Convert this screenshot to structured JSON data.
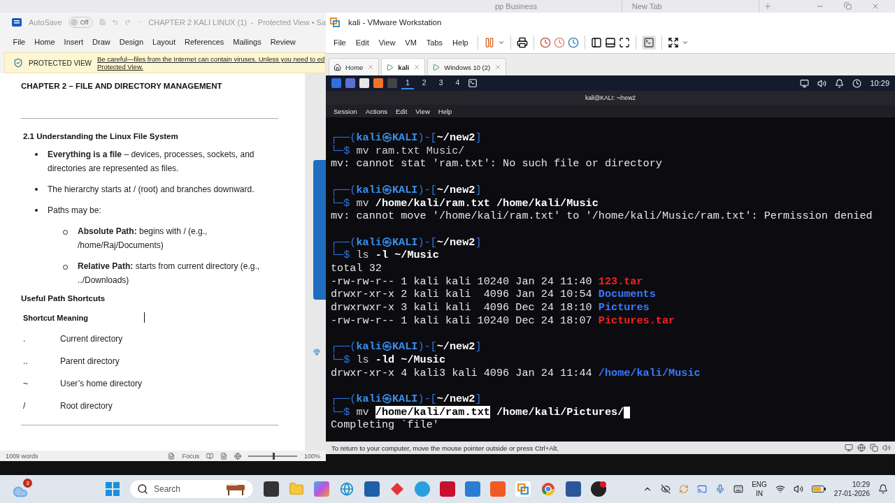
{
  "browser": {
    "tabs": [
      {
        "label": "pp Business",
        "selected": false
      },
      {
        "label": "New Tab",
        "selected": false
      }
    ]
  },
  "word": {
    "autosave": {
      "label": "AutoSave",
      "state": "Off",
      "on": false
    },
    "title": "CHAPTER 2 KALI LINUX (1)  -  Protected View • Sa",
    "ribbon_tabs": [
      "File",
      "Home",
      "Insert",
      "Draw",
      "Design",
      "Layout",
      "References",
      "Mailings",
      "Review"
    ],
    "protected_view": {
      "label": "PROTECTED VIEW",
      "message_lines": [
        "Be careful—files from the Internet can contain viruses. Unless you need to ed",
        "Protected View."
      ]
    },
    "document": {
      "heading": "CHAPTER 2 – FILE AND DIRECTORY MANAGEMENT",
      "section": "2.1 Understanding the Linux File System",
      "bullets": [
        {
          "text": "**Everything is a file** – devices, processes, sockets, and directories are represented as files."
        },
        {
          "text": "The hierarchy starts at / (root) and branches downward."
        },
        {
          "text": "Paths may be:",
          "children": [
            {
              "text": "**Absolute Path:** begins with / (e.g., /home/Raj/Documents)"
            },
            {
              "text": "**Relative Path:** starts from current directory (e.g., ../Downloads)"
            }
          ]
        }
      ],
      "subheading": "Useful Path Shortcuts",
      "table_header": "Shortcut Meaning",
      "shortcuts": [
        {
          "shortcut": ".",
          "meaning": "Current directory"
        },
        {
          "shortcut": "..",
          "meaning": "Parent directory"
        },
        {
          "shortcut": "~",
          "meaning": "User’s home directory"
        },
        {
          "shortcut": "/",
          "meaning": "Root directory"
        }
      ]
    },
    "status": {
      "words": "1009 words",
      "focus": "Focus",
      "zoom": "100%",
      "zoom_slider": {
        "level": 0.5
      }
    }
  },
  "vmware": {
    "title": "kali - VMware Workstation",
    "menu": [
      "File",
      "Edit",
      "View",
      "VM",
      "Tabs",
      "Help"
    ],
    "tabs": [
      {
        "label": "Home",
        "kind": "home",
        "selected": false
      },
      {
        "label": "kali",
        "kind": "vm",
        "selected": true
      },
      {
        "label": "Windows 10 (2)",
        "kind": "vm",
        "selected": false
      }
    ],
    "status": "To return to your computer, move the mouse pointer outside or press Ctrl+Alt."
  },
  "kali_panel": {
    "workspaces": [
      {
        "label": "1",
        "selected": true
      },
      {
        "label": "2",
        "selected": false
      },
      {
        "label": "3",
        "selected": false
      },
      {
        "label": "4",
        "selected": false
      }
    ],
    "clock": "10:29"
  },
  "terminal": {
    "title": "kali@KALI: ~/new2",
    "menu": [
      "Session",
      "Actions",
      "Edit",
      "View",
      "Help"
    ],
    "blocks": [
      {
        "lines": [
          [
            {
              "text": "┌──(",
              "kind": "frame"
            },
            {
              "text": "kali㉿KALI",
              "kind": "host"
            },
            {
              "text": ")-[",
              "kind": "frame"
            },
            {
              "text": "~/new2",
              "kind": "path"
            },
            {
              "text": "]",
              "kind": "frame"
            }
          ],
          [
            {
              "text": "└─$ ",
              "kind": "frame"
            },
            {
              "text": "mv ram.txt Music/",
              "kind": "cmd"
            }
          ],
          [
            {
              "text": "mv: cannot stat 'ram.txt': No such file or directory",
              "kind": "output"
            }
          ]
        ]
      },
      {
        "lines": [
          [
            {
              "text": "┌──(",
              "kind": "frame"
            },
            {
              "text": "kali㉿KALI",
              "kind": "host"
            },
            {
              "text": ")-[",
              "kind": "frame"
            },
            {
              "text": "~/new2",
              "kind": "path"
            },
            {
              "text": "]",
              "kind": "frame"
            }
          ],
          [
            {
              "text": "└─$ ",
              "kind": "frame"
            },
            {
              "text": "mv ",
              "kind": "cmd"
            },
            {
              "text": "/home/kali/ram.txt /home/kali/Music",
              "kind": "arg"
            }
          ],
          [
            {
              "text": "mv: cannot move '/home/kali/ram.txt' to '/home/kali/Music/ram.txt': Permission denied",
              "kind": "output"
            }
          ]
        ]
      },
      {
        "lines": [
          [
            {
              "text": "┌──(",
              "kind": "frame"
            },
            {
              "text": "kali㉿KALI",
              "kind": "host"
            },
            {
              "text": ")-[",
              "kind": "frame"
            },
            {
              "text": "~/new2",
              "kind": "path"
            },
            {
              "text": "]",
              "kind": "frame"
            }
          ],
          [
            {
              "text": "└─$ ",
              "kind": "frame"
            },
            {
              "text": "ls ",
              "kind": "cmd"
            },
            {
              "text": "-l ~/Music",
              "kind": "arg"
            }
          ],
          [
            {
              "text": "total 32",
              "kind": "output"
            }
          ],
          [
            {
              "text": "-rw-rw-r-- 1 kali kali 10240 Jan 24 11:40 ",
              "kind": "output"
            },
            {
              "text": "123.tar",
              "kind": "archive"
            }
          ],
          [
            {
              "text": "drwxr-xr-x 2 kali kali  4096 Jan 24 10:54 ",
              "kind": "output"
            },
            {
              "text": "Documents",
              "kind": "dir"
            }
          ],
          [
            {
              "text": "drwxrwxr-x 3 kali kali  4096 Dec 24 18:10 ",
              "kind": "output"
            },
            {
              "text": "Pictures",
              "kind": "dir"
            }
          ],
          [
            {
              "text": "-rw-rw-r-- 1 kali kali 10240 Dec 24 18:07 ",
              "kind": "output"
            },
            {
              "text": "Pictures.tar",
              "kind": "archive"
            }
          ]
        ]
      },
      {
        "lines": [
          [
            {
              "text": "┌──(",
              "kind": "frame"
            },
            {
              "text": "kali㉿KALI",
              "kind": "host"
            },
            {
              "text": ")-[",
              "kind": "frame"
            },
            {
              "text": "~/new2",
              "kind": "path"
            },
            {
              "text": "]",
              "kind": "frame"
            }
          ],
          [
            {
              "text": "└─$ ",
              "kind": "frame"
            },
            {
              "text": "ls ",
              "kind": "cmd"
            },
            {
              "text": "-ld ~/Music",
              "kind": "arg"
            }
          ],
          [
            {
              "text": "drwxr-xr-x 4 kali3 kali 4096 Jan 24 11:44 ",
              "kind": "output"
            },
            {
              "text": "/home/kali/Music",
              "kind": "dir"
            }
          ]
        ]
      },
      {
        "lines": [
          [
            {
              "text": "┌──(",
              "kind": "frame"
            },
            {
              "text": "kali㉿KALI",
              "kind": "host"
            },
            {
              "text": ")-[",
              "kind": "frame"
            },
            {
              "text": "~/new2",
              "kind": "path"
            },
            {
              "text": "]",
              "kind": "frame"
            }
          ],
          [
            {
              "text": "└─$ ",
              "kind": "frame"
            },
            {
              "text": "mv ",
              "kind": "cmd"
            },
            {
              "text": "/home/kali/ram.txt",
              "kind": "selected"
            },
            {
              "text": " /home/kali/Pictures/",
              "kind": "arg"
            },
            {
              "kind": "cursor"
            }
          ],
          [
            {
              "text": "Completing `file'",
              "kind": "output"
            }
          ]
        ]
      }
    ]
  },
  "taskbar": {
    "weather_badge": "3",
    "search_placeholder": "Search",
    "language": [
      "ENG",
      "IN"
    ],
    "time": "10:29",
    "date": "27-01-2026"
  }
}
